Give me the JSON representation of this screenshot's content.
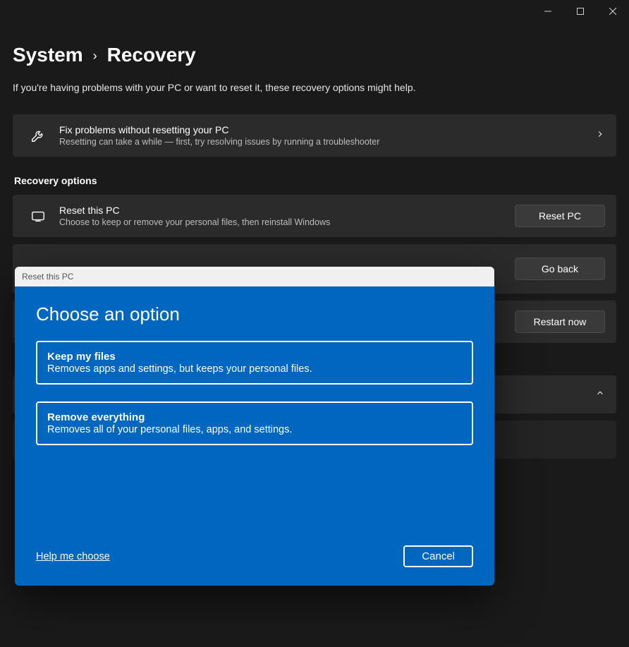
{
  "window": {
    "controls": {
      "minimize": "minimize",
      "maximize": "maximize",
      "close": "close"
    }
  },
  "breadcrumb": {
    "parent": "System",
    "separator": "›",
    "current": "Recovery"
  },
  "intro": "If you're having problems with your PC or want to reset it, these recovery options might help.",
  "fix_card": {
    "title": "Fix problems without resetting your PC",
    "subtitle": "Resetting can take a while — first, try resolving issues by running a troubleshooter"
  },
  "recovery_section_label": "Recovery options",
  "reset_card": {
    "title": "Reset this PC",
    "subtitle": "Choose to keep or remove your personal files, then reinstall Windows",
    "button": "Reset PC"
  },
  "goback_card": {
    "button": "Go back"
  },
  "restart_card": {
    "button": "Restart now"
  },
  "modal": {
    "titlebar": "Reset this PC",
    "heading": "Choose an option",
    "options": [
      {
        "title": "Keep my files",
        "desc": "Removes apps and settings, but keeps your personal files."
      },
      {
        "title": "Remove everything",
        "desc": "Removes all of your personal files, apps, and settings."
      }
    ],
    "help_link": "Help me choose",
    "cancel": "Cancel"
  }
}
